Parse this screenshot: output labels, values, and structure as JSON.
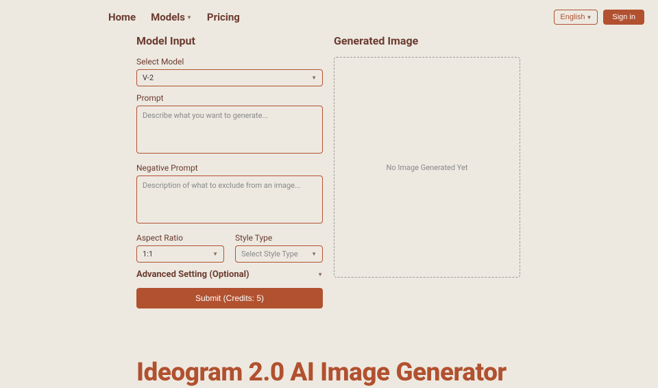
{
  "nav": {
    "home": "Home",
    "models": "Models",
    "pricing": "Pricing"
  },
  "header": {
    "language": "English",
    "signin": "Sign in"
  },
  "form": {
    "title": "Model Input",
    "selectModel": {
      "label": "Select Model",
      "value": "V-2"
    },
    "prompt": {
      "label": "Prompt",
      "placeholder": "Describe what you want to generate..."
    },
    "negativePrompt": {
      "label": "Negative Prompt",
      "placeholder": "Description of what to exclude from an image..."
    },
    "aspectRatio": {
      "label": "Aspect Ratio",
      "value": "1:1"
    },
    "styleType": {
      "label": "Style Type",
      "placeholder": "Select Style Type"
    },
    "advanced": "Advanced Setting (Optional)",
    "submit": "Submit (Credits: 5)"
  },
  "generated": {
    "title": "Generated Image",
    "empty": "No Image Generated Yet"
  },
  "hero": {
    "title": "Ideogram 2.0 AI Image Generator"
  }
}
